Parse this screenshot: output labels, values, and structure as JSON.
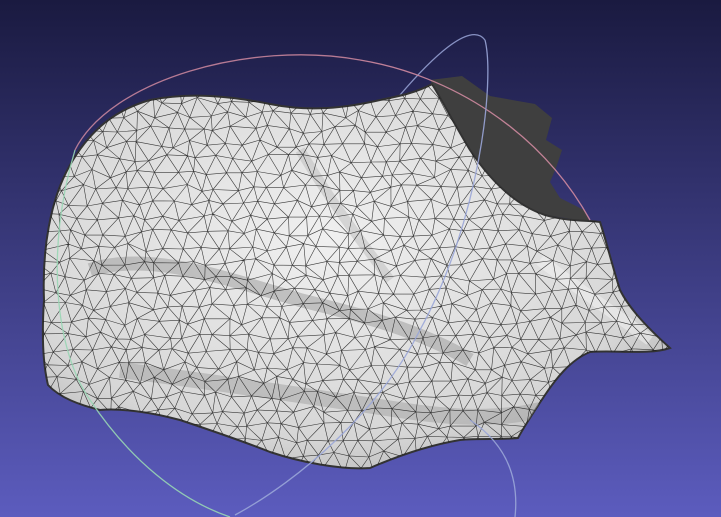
{
  "viewport": {
    "name": "3d-mesh-viewport",
    "background_top_color": "#1a1a40",
    "background_bottom_color": "#5c5cbe",
    "mesh_fill_color": "#e6e6e6",
    "mesh_shadow_color": "#3f3f3f",
    "mesh_edge_color": "#1a1a1a",
    "trackball_colors": {
      "x_ring": "#d08aa0",
      "y_ring": "#9aa6d8",
      "z_ring": "#98d6b4"
    }
  }
}
